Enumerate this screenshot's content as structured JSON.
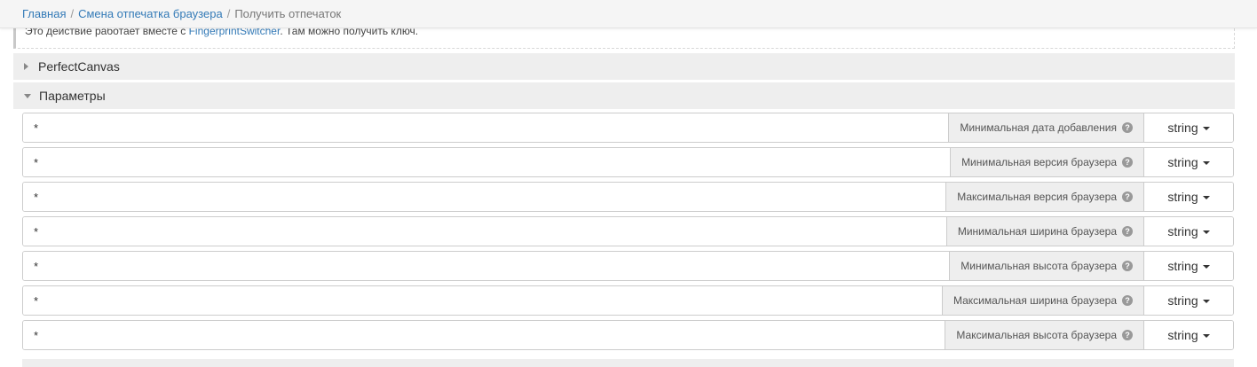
{
  "breadcrumb": {
    "home": "Главная",
    "section": "Смена отпечатка браузера",
    "current": "Получить отпечаток",
    "separator": "/"
  },
  "notice": {
    "text_before": "Это действие работает вместе с ",
    "link": "FingerprintSwitcher",
    "text_after": ". Там можно получить ключ."
  },
  "sections": {
    "perfect_canvas": {
      "label": "PerfectCanvas",
      "expanded": false
    },
    "params": {
      "label": "Параметры",
      "expanded": true
    }
  },
  "params": [
    {
      "value": "*",
      "label": "Минимальная дата добавления",
      "type": "string",
      "help": "?"
    },
    {
      "value": "*",
      "label": "Минимальная версия браузера",
      "type": "string",
      "help": "?"
    },
    {
      "value": "*",
      "label": "Максимальная версия браузера",
      "type": "string",
      "help": "?"
    },
    {
      "value": "*",
      "label": "Минимальная ширина браузера",
      "type": "string",
      "help": "?"
    },
    {
      "value": "*",
      "label": "Минимальная высота браузера",
      "type": "string",
      "help": "?"
    },
    {
      "value": "*",
      "label": "Максимальная ширина браузера",
      "type": "string",
      "help": "?"
    },
    {
      "value": "*",
      "label": "Максимальная высота браузера",
      "type": "string",
      "help": "?"
    }
  ],
  "colors": {
    "link": "#337ab7",
    "header_bg": "#eeeeee",
    "addon_bg": "#eeeeee",
    "border": "#cccccc"
  }
}
